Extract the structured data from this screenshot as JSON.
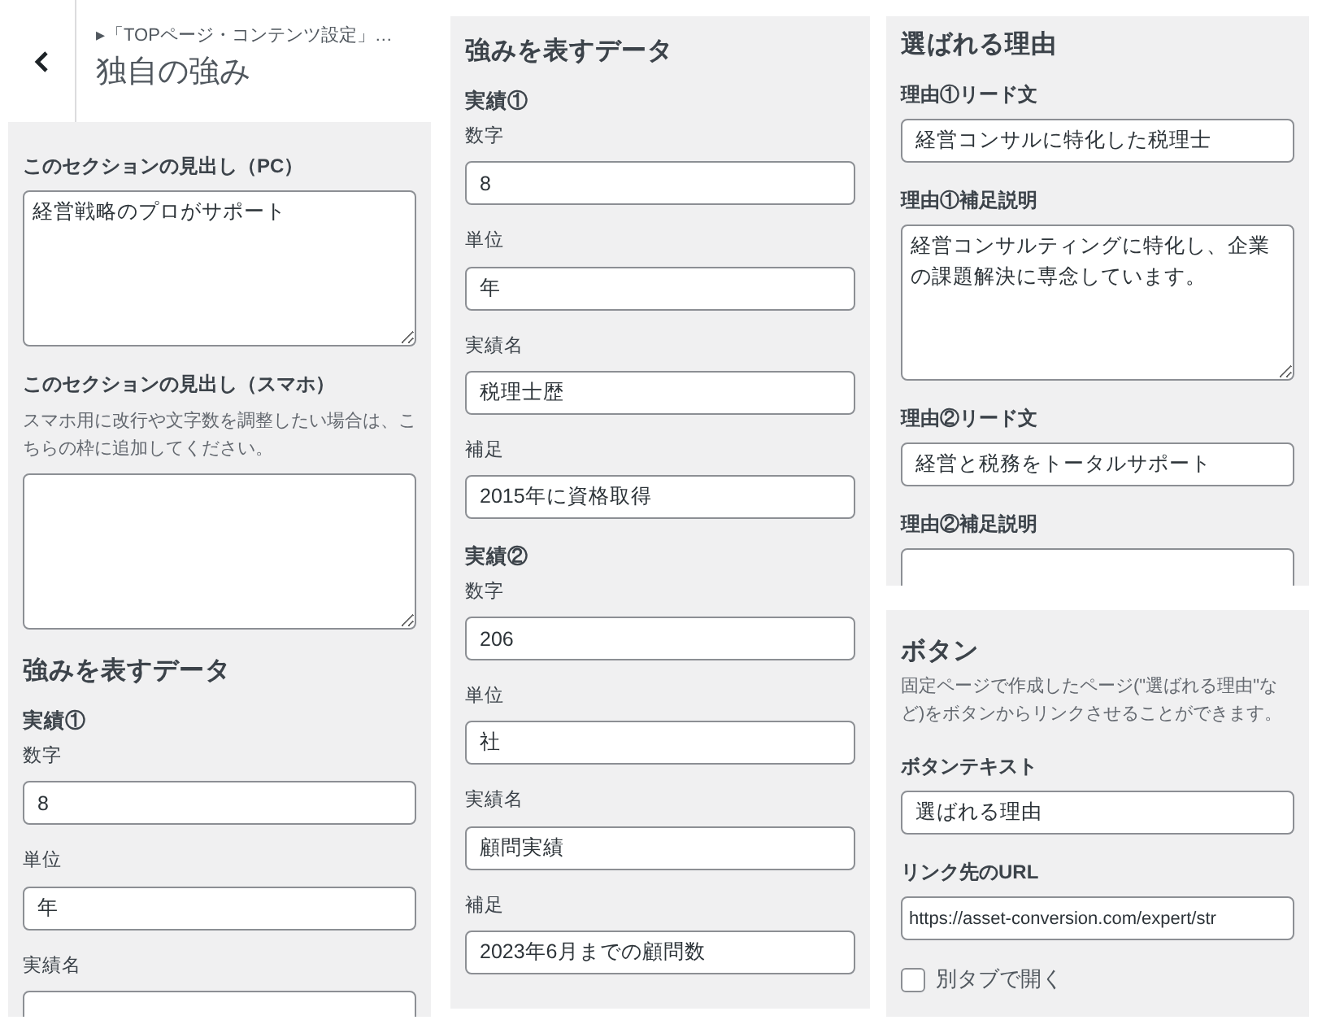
{
  "panels": [
    {
      "header": {
        "breadcrumb": "▸「TOPページ・コンテンツ設定」…",
        "title": "独自の強み"
      },
      "controls": [
        {
          "kind": "textarea",
          "label": "このセクションの見出し（PC）",
          "bold_label": true,
          "value": "経営戦略のプロがサポート"
        },
        {
          "kind": "textarea",
          "label": "このセクションの見出し（スマホ）",
          "bold_label": true,
          "note": "スマホ用に改行や文字数を調整したい場合は、こちらの枠に追加してください。"
        },
        {
          "kind": "heading",
          "text": "強みを表すデータ"
        },
        {
          "kind": "group",
          "text": "実績①"
        },
        {
          "kind": "input",
          "label": "数字",
          "bold_label": false,
          "value": "8"
        },
        {
          "kind": "input",
          "label": "単位",
          "bold_label": false,
          "value": "年"
        },
        {
          "kind": "input",
          "label": "実績名",
          "bold_label": false
        }
      ]
    },
    {
      "controls": [
        {
          "kind": "heading",
          "text": "強みを表すデータ"
        },
        {
          "kind": "group",
          "text": "実績①"
        },
        {
          "kind": "input",
          "label": "数字",
          "bold_label": false,
          "value": "8"
        },
        {
          "kind": "input",
          "label": "単位",
          "bold_label": false,
          "value": "年"
        },
        {
          "kind": "input",
          "label": "実績名",
          "bold_label": false,
          "value": "税理士歴"
        },
        {
          "kind": "input",
          "label": "補足",
          "bold_label": false,
          "value": "2015年に資格取得"
        },
        {
          "kind": "group",
          "text": "実績②"
        },
        {
          "kind": "input",
          "label": "数字",
          "bold_label": false,
          "value": "206"
        },
        {
          "kind": "input",
          "label": "単位",
          "bold_label": false,
          "value": "社"
        },
        {
          "kind": "input",
          "label": "実績名",
          "bold_label": false,
          "value": "顧問実績"
        },
        {
          "kind": "input",
          "label": "補足",
          "bold_label": false,
          "value": "2023年6月までの顧問数"
        }
      ]
    },
    {
      "controls": [
        {
          "kind": "heading",
          "text": "選ばれる理由"
        },
        {
          "kind": "input",
          "label": "理由①リード文",
          "bold_label": true,
          "value": "経営コンサルに特化した税理士"
        },
        {
          "kind": "textarea",
          "label": "理由①補足説明",
          "bold_label": true,
          "value": "経営コンサルティングに特化し、企業の課題解決に専念しています。"
        },
        {
          "kind": "input",
          "label": "理由②リード文",
          "bold_label": true,
          "value": "経営と税務をトータルサポート"
        },
        {
          "kind": "textarea",
          "label": "理由②補足説明",
          "bold_label": true
        }
      ]
    },
    {
      "controls": [
        {
          "kind": "heading",
          "text": "ボタン",
          "note": "固定ページで作成したページ(\"選ばれる理由\"など)をボタンからリンクさせることができます。"
        },
        {
          "kind": "input",
          "label": "ボタンテキスト",
          "bold_label": true,
          "value": "選ばれる理由"
        },
        {
          "kind": "input",
          "label": "リンク先のURL",
          "bold_label": true,
          "value": "https://asset-conversion.com/expert/str",
          "small": true
        },
        {
          "kind": "checkbox",
          "label": "別タブで開く",
          "checked": false
        }
      ]
    }
  ]
}
